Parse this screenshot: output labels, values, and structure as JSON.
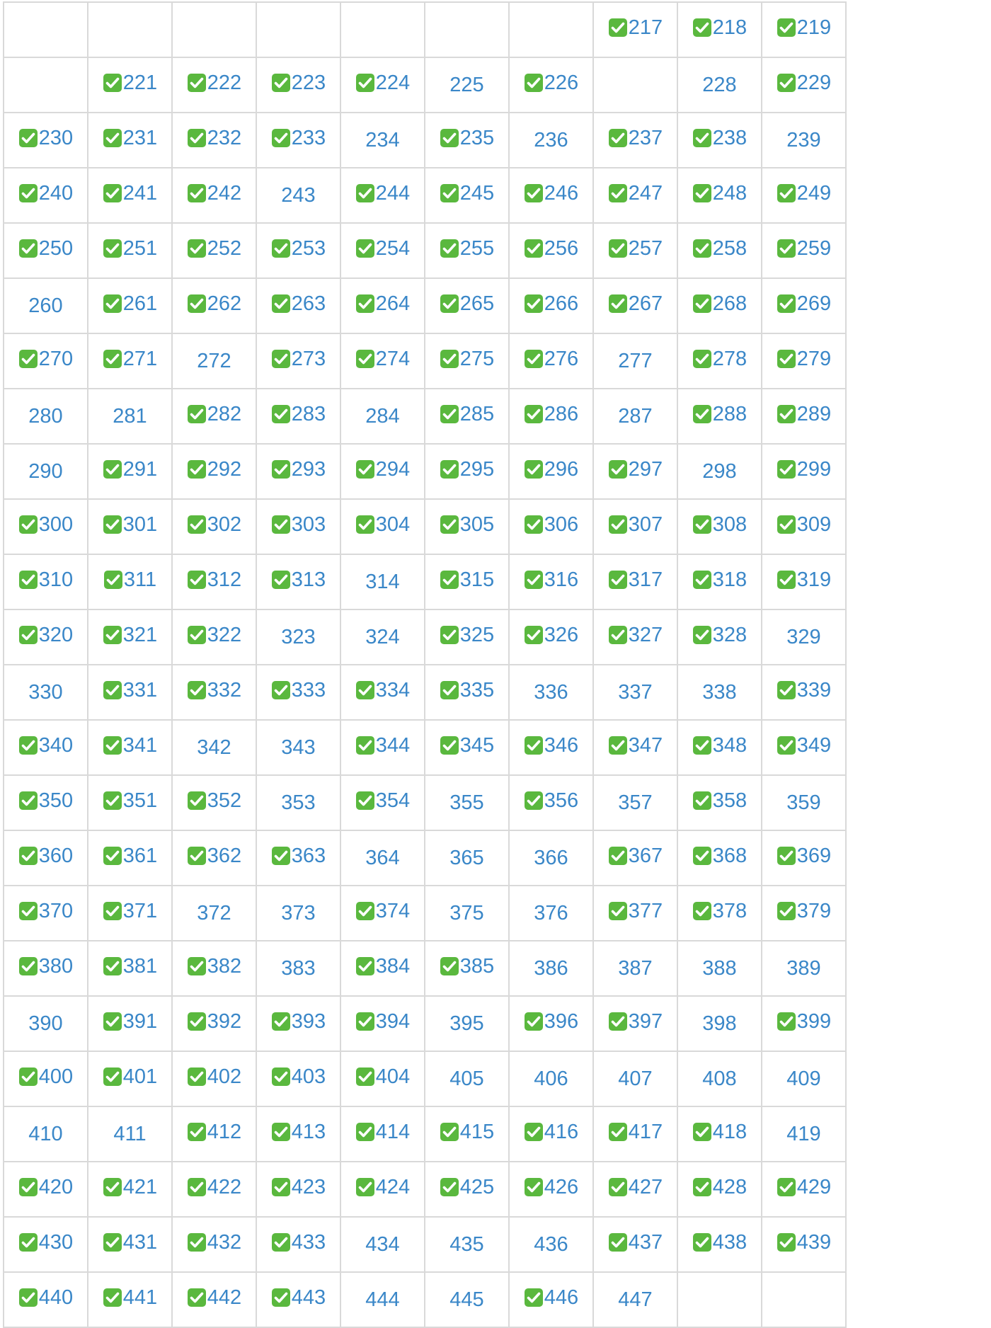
{
  "accent": "#3a87c8",
  "check_color": "#5ab83e",
  "check_icon": "white-check-mark-icon",
  "rows": [
    [
      null,
      null,
      null,
      null,
      null,
      null,
      null,
      {
        "n": "217",
        "c": true
      },
      {
        "n": "218",
        "c": true
      },
      {
        "n": "219",
        "c": true
      }
    ],
    [
      null,
      {
        "n": "221",
        "c": true
      },
      {
        "n": "222",
        "c": true
      },
      {
        "n": "223",
        "c": true
      },
      {
        "n": "224",
        "c": true
      },
      {
        "n": "225",
        "c": false
      },
      {
        "n": "226",
        "c": true
      },
      null,
      {
        "n": "228",
        "c": false
      },
      {
        "n": "229",
        "c": true
      }
    ],
    [
      {
        "n": "230",
        "c": true
      },
      {
        "n": "231",
        "c": true
      },
      {
        "n": "232",
        "c": true
      },
      {
        "n": "233",
        "c": true
      },
      {
        "n": "234",
        "c": false
      },
      {
        "n": "235",
        "c": true
      },
      {
        "n": "236",
        "c": false
      },
      {
        "n": "237",
        "c": true
      },
      {
        "n": "238",
        "c": true
      },
      {
        "n": "239",
        "c": false
      }
    ],
    [
      {
        "n": "240",
        "c": true
      },
      {
        "n": "241",
        "c": true
      },
      {
        "n": "242",
        "c": true
      },
      {
        "n": "243",
        "c": false
      },
      {
        "n": "244",
        "c": true
      },
      {
        "n": "245",
        "c": true
      },
      {
        "n": "246",
        "c": true
      },
      {
        "n": "247",
        "c": true
      },
      {
        "n": "248",
        "c": true
      },
      {
        "n": "249",
        "c": true
      }
    ],
    [
      {
        "n": "250",
        "c": true
      },
      {
        "n": "251",
        "c": true
      },
      {
        "n": "252",
        "c": true
      },
      {
        "n": "253",
        "c": true
      },
      {
        "n": "254",
        "c": true
      },
      {
        "n": "255",
        "c": true
      },
      {
        "n": "256",
        "c": true
      },
      {
        "n": "257",
        "c": true
      },
      {
        "n": "258",
        "c": true
      },
      {
        "n": "259",
        "c": true
      }
    ],
    [
      {
        "n": "260",
        "c": false
      },
      {
        "n": "261",
        "c": true
      },
      {
        "n": "262",
        "c": true
      },
      {
        "n": "263",
        "c": true
      },
      {
        "n": "264",
        "c": true
      },
      {
        "n": "265",
        "c": true
      },
      {
        "n": "266",
        "c": true
      },
      {
        "n": "267",
        "c": true
      },
      {
        "n": "268",
        "c": true
      },
      {
        "n": "269",
        "c": true
      }
    ],
    [
      {
        "n": "270",
        "c": true
      },
      {
        "n": "271",
        "c": true
      },
      {
        "n": "272",
        "c": false
      },
      {
        "n": "273",
        "c": true
      },
      {
        "n": "274",
        "c": true
      },
      {
        "n": "275",
        "c": true
      },
      {
        "n": "276",
        "c": true
      },
      {
        "n": "277",
        "c": false
      },
      {
        "n": "278",
        "c": true
      },
      {
        "n": "279",
        "c": true
      }
    ],
    [
      {
        "n": "280",
        "c": false
      },
      {
        "n": "281",
        "c": false
      },
      {
        "n": "282",
        "c": true
      },
      {
        "n": "283",
        "c": true
      },
      {
        "n": "284",
        "c": false
      },
      {
        "n": "285",
        "c": true
      },
      {
        "n": "286",
        "c": true
      },
      {
        "n": "287",
        "c": false
      },
      {
        "n": "288",
        "c": true
      },
      {
        "n": "289",
        "c": true
      }
    ],
    [
      {
        "n": "290",
        "c": false
      },
      {
        "n": "291",
        "c": true
      },
      {
        "n": "292",
        "c": true
      },
      {
        "n": "293",
        "c": true
      },
      {
        "n": "294",
        "c": true
      },
      {
        "n": "295",
        "c": true
      },
      {
        "n": "296",
        "c": true
      },
      {
        "n": "297",
        "c": true
      },
      {
        "n": "298",
        "c": false
      },
      {
        "n": "299",
        "c": true
      }
    ],
    [
      {
        "n": "300",
        "c": true
      },
      {
        "n": "301",
        "c": true
      },
      {
        "n": "302",
        "c": true
      },
      {
        "n": "303",
        "c": true
      },
      {
        "n": "304",
        "c": true
      },
      {
        "n": "305",
        "c": true
      },
      {
        "n": "306",
        "c": true
      },
      {
        "n": "307",
        "c": true
      },
      {
        "n": "308",
        "c": true
      },
      {
        "n": "309",
        "c": true
      }
    ],
    [
      {
        "n": "310",
        "c": true
      },
      {
        "n": "311",
        "c": true
      },
      {
        "n": "312",
        "c": true
      },
      {
        "n": "313",
        "c": true
      },
      {
        "n": "314",
        "c": false
      },
      {
        "n": "315",
        "c": true
      },
      {
        "n": "316",
        "c": true
      },
      {
        "n": "317",
        "c": true
      },
      {
        "n": "318",
        "c": true
      },
      {
        "n": "319",
        "c": true
      }
    ],
    [
      {
        "n": "320",
        "c": true
      },
      {
        "n": "321",
        "c": true
      },
      {
        "n": "322",
        "c": true
      },
      {
        "n": "323",
        "c": false
      },
      {
        "n": "324",
        "c": false
      },
      {
        "n": "325",
        "c": true
      },
      {
        "n": "326",
        "c": true
      },
      {
        "n": "327",
        "c": true
      },
      {
        "n": "328",
        "c": true
      },
      {
        "n": "329",
        "c": false
      }
    ],
    [
      {
        "n": "330",
        "c": false
      },
      {
        "n": "331",
        "c": true
      },
      {
        "n": "332",
        "c": true
      },
      {
        "n": "333",
        "c": true
      },
      {
        "n": "334",
        "c": true
      },
      {
        "n": "335",
        "c": true
      },
      {
        "n": "336",
        "c": false
      },
      {
        "n": "337",
        "c": false
      },
      {
        "n": "338",
        "c": false
      },
      {
        "n": "339",
        "c": true
      }
    ],
    [
      {
        "n": "340",
        "c": true
      },
      {
        "n": "341",
        "c": true
      },
      {
        "n": "342",
        "c": false
      },
      {
        "n": "343",
        "c": false
      },
      {
        "n": "344",
        "c": true
      },
      {
        "n": "345",
        "c": true
      },
      {
        "n": "346",
        "c": true
      },
      {
        "n": "347",
        "c": true
      },
      {
        "n": "348",
        "c": true
      },
      {
        "n": "349",
        "c": true
      }
    ],
    [
      {
        "n": "350",
        "c": true
      },
      {
        "n": "351",
        "c": true
      },
      {
        "n": "352",
        "c": true
      },
      {
        "n": "353",
        "c": false
      },
      {
        "n": "354",
        "c": true
      },
      {
        "n": "355",
        "c": false
      },
      {
        "n": "356",
        "c": true
      },
      {
        "n": "357",
        "c": false
      },
      {
        "n": "358",
        "c": true
      },
      {
        "n": "359",
        "c": false
      }
    ],
    [
      {
        "n": "360",
        "c": true
      },
      {
        "n": "361",
        "c": true
      },
      {
        "n": "362",
        "c": true
      },
      {
        "n": "363",
        "c": true
      },
      {
        "n": "364",
        "c": false
      },
      {
        "n": "365",
        "c": false
      },
      {
        "n": "366",
        "c": false
      },
      {
        "n": "367",
        "c": true
      },
      {
        "n": "368",
        "c": true
      },
      {
        "n": "369",
        "c": true
      }
    ],
    [
      {
        "n": "370",
        "c": true
      },
      {
        "n": "371",
        "c": true
      },
      {
        "n": "372",
        "c": false
      },
      {
        "n": "373",
        "c": false
      },
      {
        "n": "374",
        "c": true
      },
      {
        "n": "375",
        "c": false
      },
      {
        "n": "376",
        "c": false
      },
      {
        "n": "377",
        "c": true
      },
      {
        "n": "378",
        "c": true
      },
      {
        "n": "379",
        "c": true
      }
    ],
    [
      {
        "n": "380",
        "c": true
      },
      {
        "n": "381",
        "c": true
      },
      {
        "n": "382",
        "c": true
      },
      {
        "n": "383",
        "c": false
      },
      {
        "n": "384",
        "c": true
      },
      {
        "n": "385",
        "c": true
      },
      {
        "n": "386",
        "c": false
      },
      {
        "n": "387",
        "c": false
      },
      {
        "n": "388",
        "c": false
      },
      {
        "n": "389",
        "c": false
      }
    ],
    [
      {
        "n": "390",
        "c": false
      },
      {
        "n": "391",
        "c": true
      },
      {
        "n": "392",
        "c": true
      },
      {
        "n": "393",
        "c": true
      },
      {
        "n": "394",
        "c": true
      },
      {
        "n": "395",
        "c": false
      },
      {
        "n": "396",
        "c": true
      },
      {
        "n": "397",
        "c": true
      },
      {
        "n": "398",
        "c": false
      },
      {
        "n": "399",
        "c": true
      }
    ],
    [
      {
        "n": "400",
        "c": true
      },
      {
        "n": "401",
        "c": true
      },
      {
        "n": "402",
        "c": true
      },
      {
        "n": "403",
        "c": true
      },
      {
        "n": "404",
        "c": true
      },
      {
        "n": "405",
        "c": false
      },
      {
        "n": "406",
        "c": false
      },
      {
        "n": "407",
        "c": false
      },
      {
        "n": "408",
        "c": false
      },
      {
        "n": "409",
        "c": false
      }
    ],
    [
      {
        "n": "410",
        "c": false
      },
      {
        "n": "411",
        "c": false
      },
      {
        "n": "412",
        "c": true
      },
      {
        "n": "413",
        "c": true
      },
      {
        "n": "414",
        "c": true
      },
      {
        "n": "415",
        "c": true
      },
      {
        "n": "416",
        "c": true
      },
      {
        "n": "417",
        "c": true
      },
      {
        "n": "418",
        "c": true
      },
      {
        "n": "419",
        "c": false
      }
    ],
    [
      {
        "n": "420",
        "c": true
      },
      {
        "n": "421",
        "c": true
      },
      {
        "n": "422",
        "c": true
      },
      {
        "n": "423",
        "c": true
      },
      {
        "n": "424",
        "c": true
      },
      {
        "n": "425",
        "c": true
      },
      {
        "n": "426",
        "c": true
      },
      {
        "n": "427",
        "c": true
      },
      {
        "n": "428",
        "c": true
      },
      {
        "n": "429",
        "c": true
      }
    ],
    [
      {
        "n": "430",
        "c": true
      },
      {
        "n": "431",
        "c": true
      },
      {
        "n": "432",
        "c": true
      },
      {
        "n": "433",
        "c": true
      },
      {
        "n": "434",
        "c": false
      },
      {
        "n": "435",
        "c": false
      },
      {
        "n": "436",
        "c": false
      },
      {
        "n": "437",
        "c": true
      },
      {
        "n": "438",
        "c": true
      },
      {
        "n": "439",
        "c": true
      }
    ],
    [
      {
        "n": "440",
        "c": true
      },
      {
        "n": "441",
        "c": true
      },
      {
        "n": "442",
        "c": true
      },
      {
        "n": "443",
        "c": true
      },
      {
        "n": "444",
        "c": false
      },
      {
        "n": "445",
        "c": false
      },
      {
        "n": "446",
        "c": true
      },
      {
        "n": "447",
        "c": false
      },
      null,
      null
    ]
  ]
}
